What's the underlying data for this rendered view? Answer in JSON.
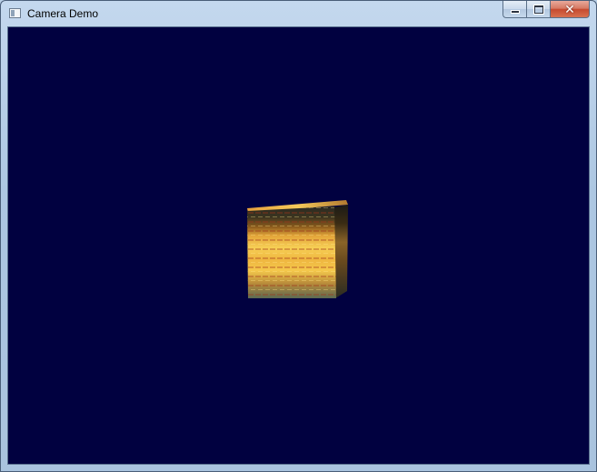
{
  "window": {
    "title": "Camera Demo",
    "icon": "app-window-icon"
  },
  "caption_buttons": {
    "minimize": "minimize-icon",
    "maximize": "maximize-icon",
    "close": "close-icon",
    "close_glyph": "✕"
  },
  "colors": {
    "viewport_background": "#010140",
    "cube_light": "#f2c347",
    "cube_dark": "#3a3018"
  }
}
